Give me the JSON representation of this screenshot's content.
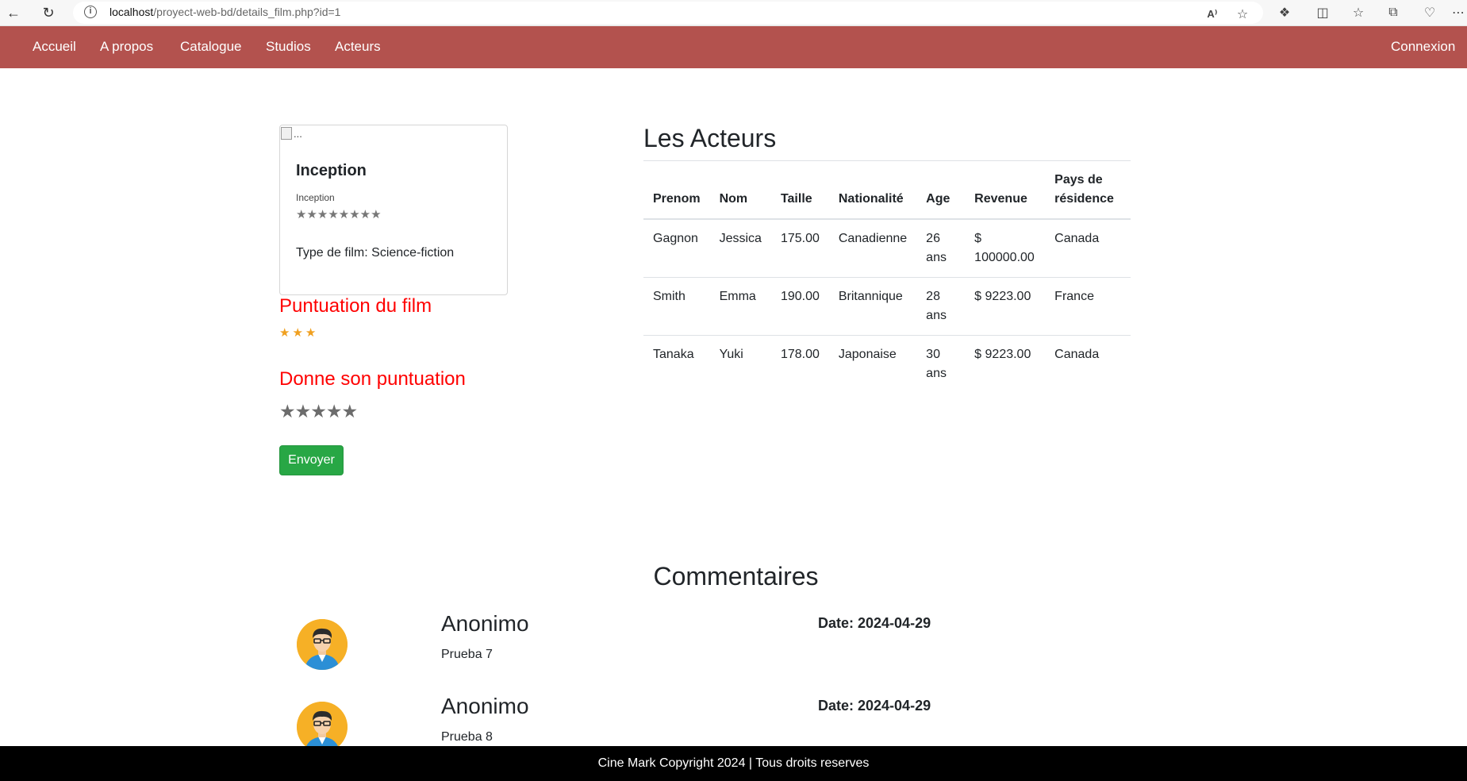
{
  "browser": {
    "url_host": "localhost",
    "url_path": "/proyect-web-bd/details_film.php?id=1"
  },
  "navbar": {
    "items": [
      "Accueil",
      "A propos",
      "Catalogue",
      "Studios",
      "Acteurs"
    ],
    "login": "Connexion"
  },
  "film": {
    "image_alt": "...",
    "title": "Inception",
    "subtitle": "Inception",
    "stars": "★★★★★★★★",
    "type": "Type de film: Science-fiction"
  },
  "rating": {
    "heading": "Puntuation du film",
    "stars": "★★★",
    "give_heading": "Donne son puntuation",
    "give_stars": "★★★★★",
    "submit": "Envoyer"
  },
  "actors": {
    "title": "Les Acteurs",
    "columns": [
      "Prenom",
      "Nom",
      "Taille",
      "Nationalité",
      "Age",
      "Revenue",
      "Pays de résidence"
    ],
    "rows": [
      [
        "Gagnon",
        "Jessica",
        "175.00",
        "Canadienne",
        "26 ans",
        "$ 100000.00",
        "Canada"
      ],
      [
        "Smith",
        "Emma",
        "190.00",
        "Britannique",
        "28 ans",
        "$ 9223.00",
        "France"
      ],
      [
        "Tanaka",
        "Yuki",
        "178.00",
        "Japonaise",
        "30 ans",
        "$ 9223.00",
        "Canada"
      ]
    ]
  },
  "comments": {
    "title": "Commentaires",
    "items": [
      {
        "author": "Anonimo",
        "text": "Prueba 7",
        "date": "Date: 2024-04-29"
      },
      {
        "author": "Anonimo",
        "text": "Prueba 8",
        "date": "Date: 2024-04-29"
      }
    ]
  },
  "footer": {
    "text": "Cine Mark Copyright 2024 | Tous droits reserves"
  },
  "colors": {
    "navbar": "#b3524e",
    "heading_red": "#ff0000",
    "button_green": "#28a745",
    "star_orange": "#f0a020",
    "footer": "#000000"
  }
}
